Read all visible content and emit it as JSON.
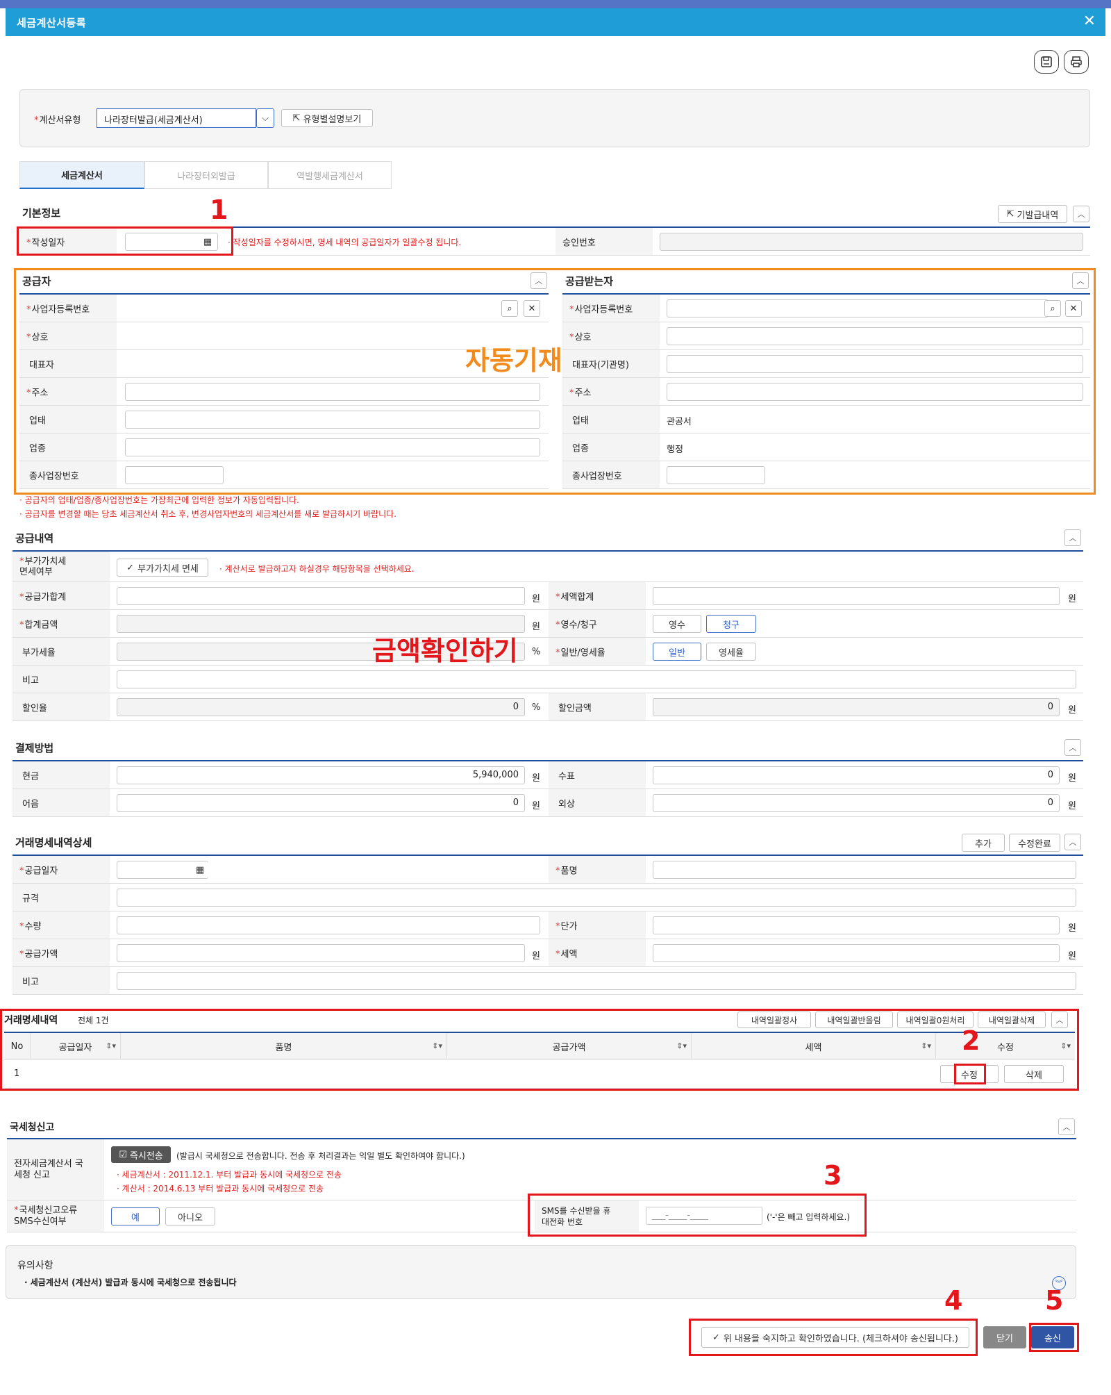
{
  "window": {
    "title": "세금계산서등록",
    "close": "✕"
  },
  "toolbar": {
    "save_icon": "save-icon",
    "print_icon": "print-icon"
  },
  "type_panel": {
    "label": "계산서유형",
    "select_value": "나라장터발급(세금계산서)",
    "guide_btn": "유형별설명보기"
  },
  "tabs": [
    "세금계산서",
    "나라장터외발급",
    "역발행세금계산서"
  ],
  "basic": {
    "title": "기본정보",
    "history_btn": "기발급내역",
    "date_label": "작성일자",
    "date_note": "· 작성일자를 수정하시면, 명세 내역의 공급일자가 일괄수정 됩니다.",
    "approval_label": "승인번호"
  },
  "supplier": {
    "title": "공급자",
    "fields": [
      "사업자등록번호",
      "상호",
      "대표자",
      "주소",
      "업태",
      "업종",
      "종사업장번호"
    ]
  },
  "receiver": {
    "title": "공급받는자",
    "fields": [
      "사업자등록번호",
      "상호",
      "대표자(기관명)",
      "주소",
      "업태",
      "업종",
      "종사업장번호"
    ],
    "business_type": "관공서",
    "business_item": "행정"
  },
  "auto_fill_text": "자동기재",
  "supplier_notes": [
    "· 공급자의 업태/업종/종사업장번호는 가장최근에 입력한 정보가 자동입력됩니다.",
    "· 공급자를 변경할 때는 당초 세금계산서 취소 후, 변경사업자번호의 세금계산서를 새로 발급하시기 바랍니다."
  ],
  "supply": {
    "title": "공급내역",
    "vat_exempt_label": "부가가치세 면세여부",
    "vat_exempt_btn": "부가가치세 면세",
    "vat_note": "· 계산서로 발급하고자 하실경우 해당항목을 선택하세요.",
    "supply_total": "공급가합계",
    "tax_total": "세액합계",
    "total_amount": "합계금액",
    "receipt_claim": "영수/청구",
    "receipt_btn": "영수",
    "claim_btn": "청구",
    "vat_rate": "부가세율",
    "general_zero": "일반/영세율",
    "general_btn": "일반",
    "zero_btn": "영세율",
    "remark": "비고",
    "discount_rate": "할인율",
    "discount_rate_value": "0",
    "discount_amount": "할인금액",
    "discount_amount_value": "0",
    "won": "원",
    "percent": "%"
  },
  "amount_check_text": "금액확인하기",
  "payment": {
    "title": "결제방법",
    "cash": "현금",
    "cash_value": "5,940,000",
    "check": "수표",
    "check_value": "0",
    "note": "어음",
    "note_value": "0",
    "credit": "외상",
    "credit_value": "0"
  },
  "detail": {
    "title": "거래명세내역상세",
    "add_btn": "추가",
    "done_btn": "수정완료",
    "supply_date": "공급일자",
    "item": "품명",
    "spec": "규격",
    "qty": "수량",
    "unit_price": "단가",
    "supply_amount": "공급가액",
    "tax": "세액",
    "remark": "비고"
  },
  "list": {
    "title": "거래명세내역",
    "count": "전체 1건",
    "btns": [
      "내역일괄정사",
      "내역일괄반올림",
      "내역일괄0원처리",
      "내역일괄삭제"
    ],
    "headers": [
      "No",
      "공급일자",
      "품명",
      "공급가액",
      "세액",
      "수정"
    ],
    "row_no": "1",
    "edit_btn": "수정",
    "delete_btn": "삭제"
  },
  "nts": {
    "title": "국세청신고",
    "e_label": "전자세금계산서 국세청 신고",
    "instant_btn": "즉시전송",
    "instant_note": "(발급시 국세청으로 전송합니다. 전송 후 처리결과는 익일 별도 확인하여야 합니다.)",
    "note1": "· 세금계산서 : 2011.12.1. 부터 발급과 동시에 국세청으로 전송",
    "note2": "· 계산서 : 2014.6.13 부터 발급과 동시에 국세청으로 전송",
    "sms_label": "국세청신고오류 SMS수신여부",
    "yes_btn": "예",
    "no_btn": "아니오",
    "phone_label": "SMS를 수신받을 휴대전화 번호",
    "phone_placeholder": "___-____-____",
    "phone_note": "('-'은 빼고 입력하세요.)"
  },
  "caution": {
    "title": "유의사항",
    "text": "· 세금계산서 (계산서) 발급과 동시에 국세청으로 전송됩니다"
  },
  "footer": {
    "confirm": "위 내용을 숙지하고 확인하였습니다. (체크하셔야 송신됩니다.)",
    "close_btn": "닫기",
    "send_btn": "송신"
  },
  "steps": [
    "1",
    "2",
    "3",
    "4",
    "5"
  ]
}
